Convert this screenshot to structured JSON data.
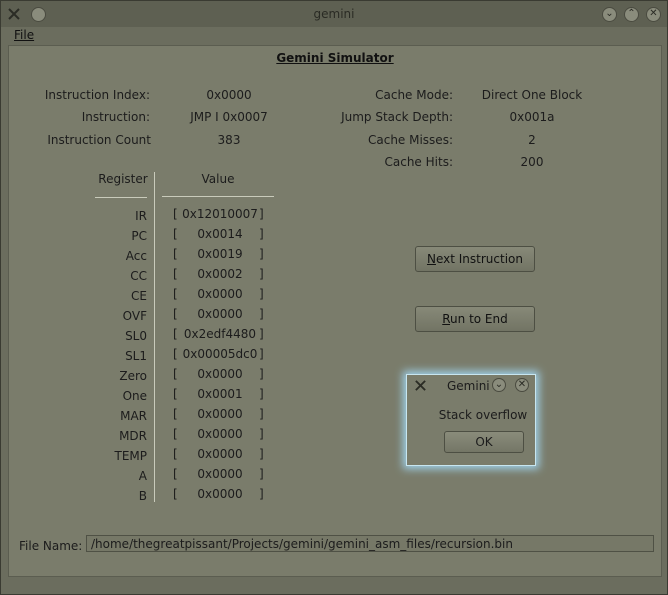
{
  "window": {
    "title": "gemini"
  },
  "menu": {
    "file": "File"
  },
  "simulator": {
    "title": "Gemini Simulator"
  },
  "stats_left": [
    {
      "label": "Instruction Index:",
      "value": "0x0000"
    },
    {
      "label": "Instruction:",
      "value": "JMP I 0x0007"
    },
    {
      "label": "Instruction Count",
      "value": "383"
    }
  ],
  "stats_right": [
    {
      "label": "Cache Mode:",
      "value": "Direct One Block"
    },
    {
      "label": "Jump Stack Depth:",
      "value": "0x001a"
    },
    {
      "label": "Cache Misses:",
      "value": "2"
    },
    {
      "label": "Cache Hits:",
      "value": "200"
    }
  ],
  "registers": {
    "header_register": "Register",
    "header_value": "Value",
    "rows": [
      {
        "name": "IR",
        "value": "0x12010007"
      },
      {
        "name": "PC",
        "value": "0x0014"
      },
      {
        "name": "Acc",
        "value": "0x0019"
      },
      {
        "name": "CC",
        "value": "0x0002"
      },
      {
        "name": "CE",
        "value": "0x0000"
      },
      {
        "name": "OVF",
        "value": "0x0000"
      },
      {
        "name": "SL0",
        "value": "0x2edf4480"
      },
      {
        "name": "SL1",
        "value": "0x00005dc0"
      },
      {
        "name": "Zero",
        "value": "0x0000"
      },
      {
        "name": "One",
        "value": "0x0001"
      },
      {
        "name": "MAR",
        "value": "0x0000"
      },
      {
        "name": "MDR",
        "value": "0x0000"
      },
      {
        "name": "TEMP",
        "value": "0x0000"
      },
      {
        "name": "A",
        "value": "0x0000"
      },
      {
        "name": "B",
        "value": "0x0000"
      }
    ],
    "bracket_open": "[",
    "bracket_close": "]"
  },
  "buttons": {
    "next_instruction_mnemonic": "N",
    "next_instruction_rest": "ext Instruction",
    "run_to_end_mnemonic": "R",
    "run_to_end_rest": "un to End"
  },
  "file": {
    "label": "File Name:",
    "path": "/home/thegreatpissant/Projects/gemini/gemini_asm_files/recursion.bin"
  },
  "dialog": {
    "title": "Gemini",
    "message": "Stack overflow",
    "ok": "OK"
  },
  "icons": {
    "app_icon": "tools-icon",
    "close": "close-icon",
    "minimize": "minimize-icon",
    "maximize": "maximize-icon"
  }
}
